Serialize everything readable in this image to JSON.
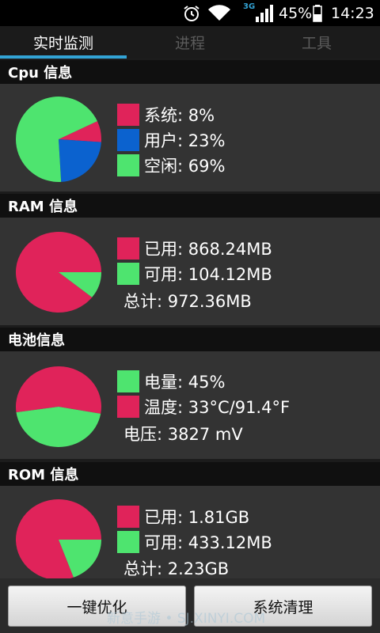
{
  "status_bar": {
    "network": "3G",
    "battery": "45%",
    "time": "14:23"
  },
  "tabs": [
    {
      "label": "实时监测",
      "active": true
    },
    {
      "label": "进程",
      "active": false
    },
    {
      "label": "工具",
      "active": false
    }
  ],
  "colors": {
    "red": "#e0235a",
    "blue": "#0b62cf",
    "green": "#4ee46f",
    "accent": "#33a4d6"
  },
  "cpu": {
    "title": "Cpu 信息",
    "legend": [
      {
        "label": "系统: 8%",
        "color": "#e0235a",
        "value": 8
      },
      {
        "label": "用户: 23%",
        "color": "#0b62cf",
        "value": 23
      },
      {
        "label": "空闲: 69%",
        "color": "#4ee46f",
        "value": 69
      }
    ]
  },
  "ram": {
    "title": "RAM 信息",
    "legend": [
      {
        "label": "已用: 868.24MB",
        "color": "#e0235a",
        "value": 868.24
      },
      {
        "label": "可用: 104.12MB",
        "color": "#4ee46f",
        "value": 104.12
      }
    ],
    "total": "总计: 972.36MB"
  },
  "battery": {
    "title": "电池信息",
    "legend": [
      {
        "label": "电量: 45%",
        "color": "#4ee46f",
        "value": 45
      },
      {
        "label": "温度: 33°C/91.4°F",
        "color": "#e0235a",
        "value": 55
      }
    ],
    "voltage": "电压: 3827 mV"
  },
  "rom": {
    "title": "ROM 信息",
    "legend": [
      {
        "label": "已用: 1.81GB",
        "color": "#e0235a",
        "value": 1.81
      },
      {
        "label": "可用: 433.12MB",
        "color": "#4ee46f",
        "value": 0.433
      }
    ],
    "total": "总计: 2.23GB"
  },
  "buttons": {
    "optimize": "一键优化",
    "clean": "系统清理"
  },
  "watermark": "新意手游 • SJ.XINYI.COM"
}
